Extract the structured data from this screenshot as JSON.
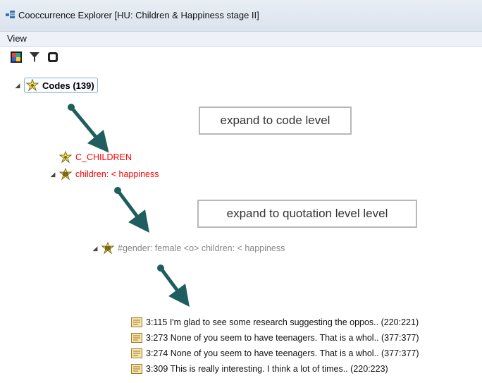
{
  "window": {
    "title": "Cooccurrence Explorer  [HU: Children & Happiness stage II]"
  },
  "menu": {
    "view_label": "View"
  },
  "toolbar": {
    "icons": [
      "color-tree-icon",
      "filter-icon",
      "stop-icon"
    ]
  },
  "tree": {
    "root": {
      "label": "Codes (139)"
    },
    "code1": {
      "label": "C_CHILDREN"
    },
    "code2": {
      "label": "children: < happiness"
    },
    "code3": {
      "label": "#gender: female <o> children: < happiness"
    },
    "quotations": [
      {
        "label": "3:115 I'm glad to see some research suggesting the oppos.. (220:221)"
      },
      {
        "label": "3:273 None of you seem to have teenagers. That is a whol.. (377:377)"
      },
      {
        "label": "3:274 None of you seem to have teenagers. That is a whol.. (377:377)"
      },
      {
        "label": "3:309 This is really interesting. I think a lot of times.. (220:223)"
      }
    ]
  },
  "annotations": {
    "callout1": "expand to code level",
    "callout2": "expand to quotation level level"
  },
  "colors": {
    "arrow": "#1f5e5e",
    "code_red": "#ff0000",
    "grey_text": "#888888"
  }
}
